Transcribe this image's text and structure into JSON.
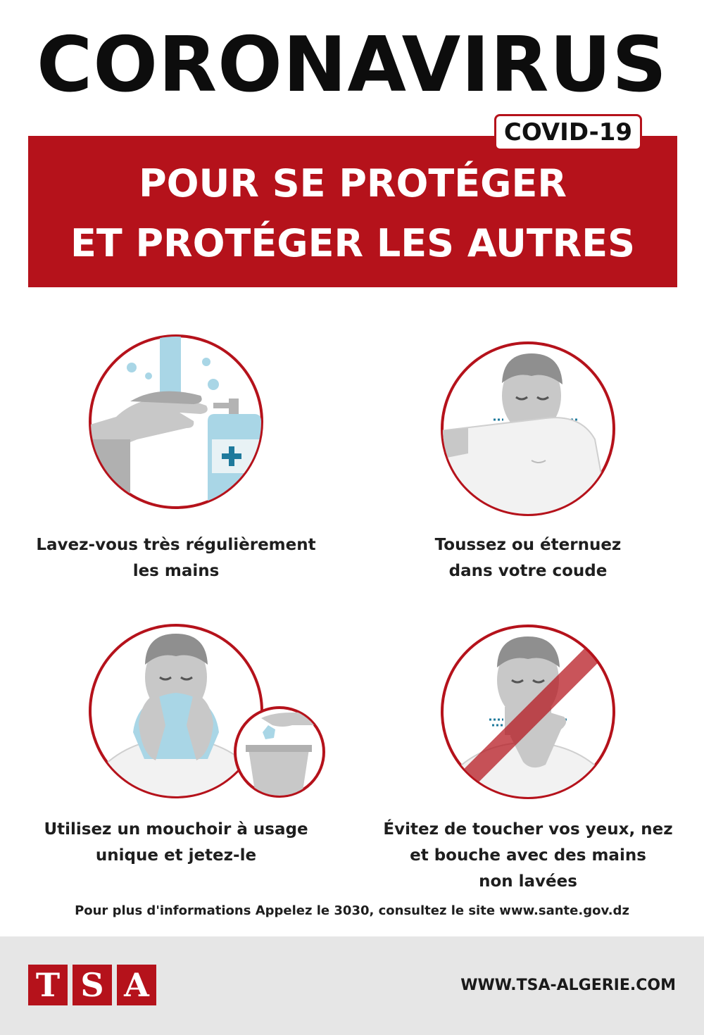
{
  "header": {
    "title": "CORONAVIRUS",
    "badge": "COVID-19",
    "banner_line1": "POUR SE PROTÉGER",
    "banner_line2": "ET PROTÉGER LES AUTRES"
  },
  "tips": [
    {
      "line1": "Lavez-vous très régulièrement",
      "line2": "les mains",
      "icon": "hand-washing-icon"
    },
    {
      "line1": "Toussez ou éternuez",
      "line2": "dans votre coude",
      "icon": "cough-elbow-icon"
    },
    {
      "line1": "Utilisez un mouchoir à usage",
      "line2": "unique et jetez-le",
      "icon": "tissue-icon"
    },
    {
      "line1": "Évitez de toucher vos yeux, nez",
      "line2": "et bouche avec des mains",
      "line3": "non lavées",
      "icon": "no-face-touch-icon"
    }
  ],
  "footer": {
    "note": "Pour plus d'informations Appelez le 3030, consultez le site www.sante.gov.dz",
    "logo_letters": [
      "T",
      "S",
      "A"
    ],
    "website": "WWW.TSA-ALGERIE.COM"
  },
  "colors": {
    "brand_red": "#b5121b",
    "footer_gray": "#e6e6e6",
    "icon_gray": "#b3b3b3",
    "water_blue": "#a9d6e6"
  }
}
